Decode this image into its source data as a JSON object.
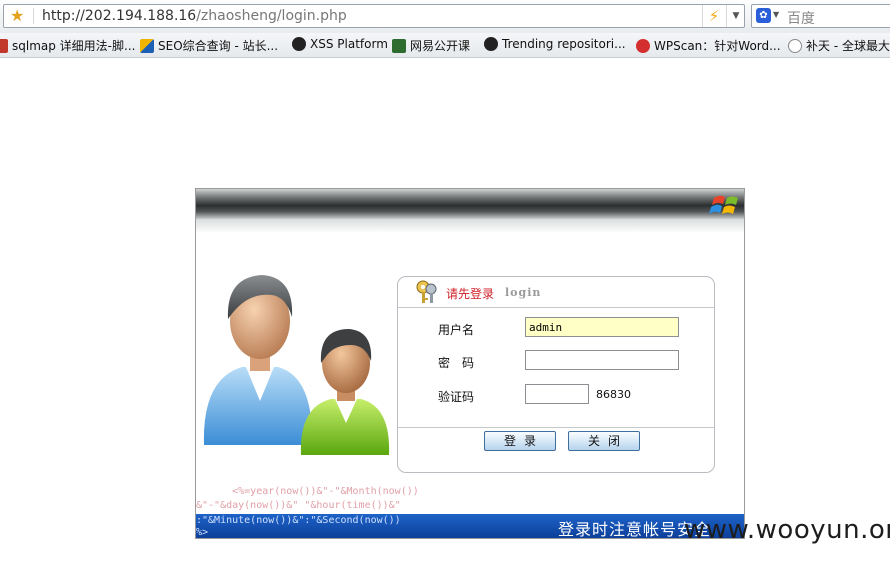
{
  "browser": {
    "url_host": "http://202.194.188.16",
    "url_path": "/zhaosheng/login.php",
    "search_placeholder": "百度"
  },
  "bookmarks": [
    {
      "label": "sqlmap 详细用法-脚...",
      "icon": "sqlmap-icon",
      "color": "#c0392b"
    },
    {
      "label": "SEO综合查询 - 站长...",
      "icon": "seo-icon",
      "color": "#f0b400"
    },
    {
      "label": "XSS Platform",
      "icon": "xss-skull-icon",
      "color": "#222222"
    },
    {
      "label": "网易公开课",
      "icon": "netease-icon",
      "color": "#2e6b2e"
    },
    {
      "label": "Trending repositori...",
      "icon": "github-icon",
      "color": "#222222"
    },
    {
      "label": "WPScan：针对Word...",
      "icon": "wpscan-icon",
      "color": "#d32f2f"
    },
    {
      "label": "补天 - 全球最大",
      "icon": "butian-star-icon",
      "color": "#777777"
    }
  ],
  "login": {
    "title": "请先登录",
    "title_en": "login",
    "username_label": "用户名",
    "username_value": "admin",
    "password_label": "密　码",
    "password_value": "",
    "captcha_label": "验证码",
    "captcha_value": "",
    "captcha_code": "86830",
    "login_button": "登录",
    "close_button": "关闭"
  },
  "asp_lines": [
    "      <%=year(now())&\"-\"&Month(now())",
    "&\"-\"&day(now())&\" \"&hour(time())&\""
  ],
  "footer": {
    "code_lines": [
      ":\"&Minute(now())&\":\"&Second(now())",
      "%>"
    ],
    "notice": "登录时注意帐号安全"
  },
  "watermark": "www.wooyun.org",
  "colors": {
    "accent_red": "#d0202a",
    "footer_blue": "#1e63c8",
    "field_highlight": "#ffffc6"
  }
}
